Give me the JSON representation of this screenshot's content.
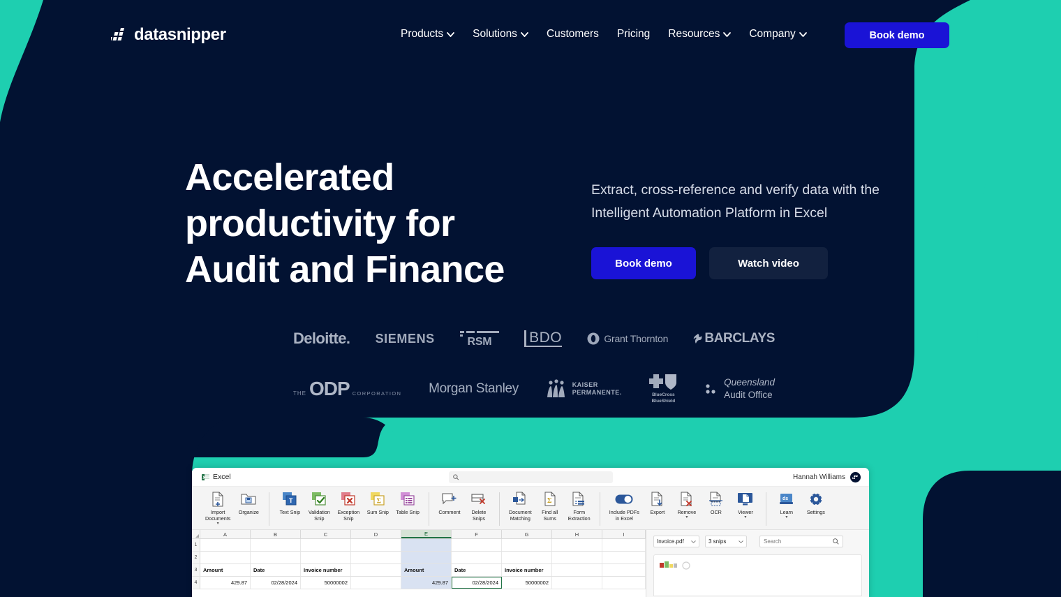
{
  "colors": {
    "navy": "#021232",
    "teal": "#1ECFB0",
    "accent_blue": "#1A13D6",
    "secondary_btn": "#12213F",
    "body_text": "#D6DCE8"
  },
  "header": {
    "logo_text": "datasnipper",
    "logo_icon": "datasnipper-bars-icon",
    "nav": [
      {
        "label": "Products",
        "has_dropdown": true
      },
      {
        "label": "Solutions",
        "has_dropdown": true
      },
      {
        "label": "Customers",
        "has_dropdown": false
      },
      {
        "label": "Pricing",
        "has_dropdown": false
      },
      {
        "label": "Resources",
        "has_dropdown": true
      },
      {
        "label": "Company",
        "has_dropdown": true
      }
    ],
    "cta_label": "Book demo"
  },
  "hero": {
    "title_lines": [
      "Accelerated",
      "productivity for",
      "Audit and Finance"
    ],
    "title": "Accelerated productivity for Audit and Finance",
    "subtitle": "Extract, cross-reference and verify data with the Intelligent Automation Platform in Excel",
    "primary_button": "Book demo",
    "secondary_button": "Watch video"
  },
  "clients": {
    "row1": [
      {
        "name": "Deloitte."
      },
      {
        "name": "SIEMENS"
      },
      {
        "name": "RSM"
      },
      {
        "name": "BDO"
      },
      {
        "name": "Grant Thornton"
      },
      {
        "name": "BARCLAYS"
      }
    ],
    "row2": [
      {
        "name": "THE ODP CORPORATION"
      },
      {
        "name": "Morgan Stanley"
      },
      {
        "name": "KAISER PERMANENTE."
      },
      {
        "name": "BlueCross BlueShield"
      },
      {
        "name": "Queensland Audit Office"
      }
    ]
  },
  "app": {
    "title": "Excel",
    "title_icon": "excel-icon",
    "search_placeholder": "",
    "search_icon": "search-icon",
    "user_name": "Hannah Williams",
    "avatar_icon": "datasnipper-avatar-icon",
    "ribbon": [
      {
        "label": "Import\nDocuments",
        "icon": "import-documents-icon",
        "caret": true
      },
      {
        "label": "Organize",
        "icon": "organize-icon",
        "caret": false
      },
      {
        "sep": true
      },
      {
        "label": "Text Snip",
        "icon": "text-snip-icon",
        "caret": false
      },
      {
        "label": "Validation\nSnip",
        "icon": "validation-snip-icon",
        "caret": false
      },
      {
        "label": "Exception\nSnip",
        "icon": "exception-snip-icon",
        "caret": false
      },
      {
        "label": "Sum Snip",
        "icon": "sum-snip-icon",
        "caret": false
      },
      {
        "label": "Table Snip",
        "icon": "table-snip-icon",
        "caret": false
      },
      {
        "sep": true
      },
      {
        "label": "Comment",
        "icon": "comment-icon",
        "caret": false
      },
      {
        "label": "Delete\nSnips",
        "icon": "delete-snips-icon",
        "caret": false
      },
      {
        "sep": true
      },
      {
        "label": "Document\nMatching",
        "icon": "document-matching-icon",
        "caret": false
      },
      {
        "label": "Find all\nSums",
        "icon": "find-all-sums-icon",
        "caret": false
      },
      {
        "label": "Form\nExtraction",
        "icon": "form-extraction-icon",
        "caret": false
      },
      {
        "sep": true
      },
      {
        "label": "Include PDFs\nin Excel",
        "icon": "toggle-on-icon",
        "caret": false
      },
      {
        "label": "Export",
        "icon": "export-icon",
        "caret": false
      },
      {
        "label": "Remove",
        "icon": "remove-icon",
        "caret": true
      },
      {
        "label": "OCR",
        "icon": "ocr-icon",
        "caret": false
      },
      {
        "label": "Viewer",
        "icon": "viewer-icon",
        "caret": true
      },
      {
        "sep": true
      },
      {
        "label": "Learn",
        "icon": "learn-icon",
        "caret": true
      },
      {
        "label": "Settings",
        "icon": "settings-gear-icon",
        "caret": false
      }
    ],
    "sheet": {
      "columns": [
        "A",
        "B",
        "C",
        "D",
        "E",
        "F",
        "G",
        "H",
        "I"
      ],
      "selected_column": "E",
      "active_cell": "F4",
      "rows": [
        {
          "num": "1",
          "cells": [
            "",
            "",
            "",
            "",
            "",
            "",
            "",
            "",
            ""
          ]
        },
        {
          "num": "2",
          "cells": [
            "",
            "",
            "",
            "",
            "",
            "",
            "",
            "",
            ""
          ]
        },
        {
          "num": "3",
          "cells": [
            "Amount",
            "Date",
            "Invoice number",
            "",
            "Amount",
            "Date",
            "Invoice number",
            "",
            ""
          ]
        },
        {
          "num": "4",
          "cells": [
            "429.87",
            "02/28/2024",
            "50000002",
            "",
            "429.87",
            "02/28/2024",
            "50000002",
            "",
            ""
          ]
        }
      ]
    },
    "pane": {
      "file_select": "Invoice.pdf",
      "snips_select": "3 snips",
      "search_placeholder": "Search",
      "search_icon": "search-icon",
      "chevron_icon": "chevron-down-icon"
    }
  }
}
